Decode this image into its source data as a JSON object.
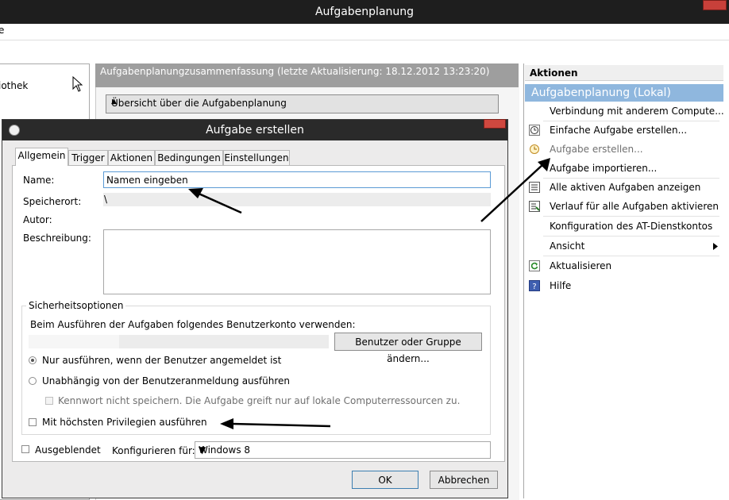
{
  "window": {
    "title": "Aufgabenplanung",
    "menu_fragment": "e"
  },
  "navigation": {
    "item_fragment": "iothek"
  },
  "summary": {
    "header": "Aufgabenplanungzusammenfassung (letzte Aktualisierung: 18.12.2012 13:23:20)",
    "overview_label": "Übersicht über die Aufgabenplanung"
  },
  "actions": {
    "header": "Aktionen",
    "section": "Aufgabenplanung (Lokal)",
    "items": [
      {
        "label": "Verbindung mit anderem Compute...",
        "icon": "none"
      },
      {
        "label": "Einfache Aufgabe erstellen...",
        "icon": "clock-wizard-icon"
      },
      {
        "label": "Aufgabe erstellen...",
        "icon": "clock-icon",
        "disabled": true
      },
      {
        "label": "Aufgabe importieren...",
        "icon": "none"
      },
      {
        "label": "Alle aktiven Aufgaben anzeigen",
        "icon": "list-icon"
      },
      {
        "label": "Verlauf für alle Aufgaben aktivieren",
        "icon": "history-icon"
      },
      {
        "label": "Konfiguration des AT-Dienstkontos",
        "icon": "none"
      },
      {
        "label": "Ansicht",
        "icon": "none",
        "submenu": true
      },
      {
        "label": "Aktualisieren",
        "icon": "refresh-icon"
      },
      {
        "label": "Hilfe",
        "icon": "help-icon"
      }
    ]
  },
  "dialog": {
    "title": "Aufgabe erstellen",
    "tabs": [
      "Allgemein",
      "Trigger",
      "Aktionen",
      "Bedingungen",
      "Einstellungen"
    ],
    "name_label": "Name:",
    "name_value": "Namen eingeben",
    "location_label": "Speicherort:",
    "location_value": "\\",
    "author_label": "Autor:",
    "description_label": "Beschreibung:",
    "security": {
      "legend": "Sicherheitsoptionen",
      "account_text": "Beim Ausführen der Aufgaben folgendes Benutzerkonto verwenden:",
      "change_user_button": "Benutzer oder Gruppe ändern...",
      "radio_logged_on": "Nur ausführen, wenn der Benutzer angemeldet ist",
      "radio_independent": "Unabhängig von der Benutzeranmeldung ausführen",
      "no_password": "Kennwort nicht speichern. Die Aufgabe greift nur auf lokale Computerressourcen zu.",
      "highest_privileges": "Mit höchsten Privilegien ausführen"
    },
    "hidden_label": "Ausgeblendet",
    "configure_label": "Konfigurieren für:",
    "configure_value": "Windows 8",
    "ok_button": "OK",
    "cancel_button": "Abbrechen"
  },
  "colors": {
    "titlebar": "#1e1e1e",
    "actions_section": "#8fb7de",
    "summary_header": "#9e9e9e",
    "focus_border": "#5b9bd5",
    "close_button": "#c8403a"
  }
}
